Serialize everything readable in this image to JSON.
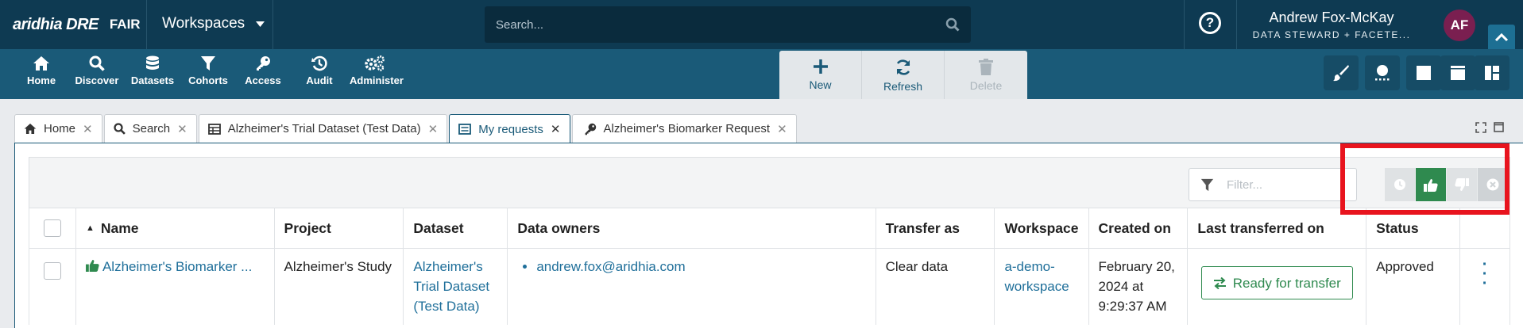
{
  "brand": {
    "logo": "aridhia DRE",
    "fair": "FAIR"
  },
  "header": {
    "workspaces_label": "Workspaces",
    "search_placeholder": "Search...",
    "help": "?",
    "user_name": "Andrew Fox-McKay",
    "user_role": "DATA STEWARD + FACETE...",
    "avatar_initials": "AF"
  },
  "nav": [
    {
      "label": "Home",
      "icon": "home-icon"
    },
    {
      "label": "Discover",
      "icon": "search-icon"
    },
    {
      "label": "Datasets",
      "icon": "database-icon"
    },
    {
      "label": "Cohorts",
      "icon": "filter-icon"
    },
    {
      "label": "Access",
      "icon": "key-icon"
    },
    {
      "label": "Audit",
      "icon": "history-icon"
    },
    {
      "label": "Administer",
      "icon": "cogs-icon"
    }
  ],
  "actions": {
    "new": "New",
    "refresh": "Refresh",
    "delete": "Delete"
  },
  "tabs": [
    {
      "label": "Home",
      "icon": "home-icon"
    },
    {
      "label": "Search",
      "icon": "search-icon"
    },
    {
      "label": "Alzheimer's Trial Dataset (Test Data)",
      "icon": "table-icon"
    },
    {
      "label": "My requests",
      "icon": "list-icon"
    },
    {
      "label": "Alzheimer's Biomarker Request",
      "icon": "key-icon"
    }
  ],
  "filter": {
    "placeholder": "Filter..."
  },
  "status_filters": [
    "pending",
    "approved",
    "rejected",
    "cancelled"
  ],
  "table": {
    "columns": [
      "Name",
      "Project",
      "Dataset",
      "Data owners",
      "Transfer as",
      "Workspace",
      "Created on",
      "Last transferred on",
      "Status"
    ],
    "rows": [
      {
        "name": "Alzheimer's Biomarker ...",
        "project": "Alzheimer's Study",
        "dataset": "Alzheimer's Trial Dataset (Test Data)",
        "owner": "andrew.fox@aridhia.com",
        "transfer_as": "Clear data",
        "workspace": "a-demo-workspace",
        "created_on": "February 20, 2024 at 9:29:37 AM",
        "last_transferred": "Ready for transfer",
        "status": "Approved"
      }
    ]
  },
  "colors": {
    "header": "#0e3a52",
    "toolbar": "#1a5a78",
    "approved": "#2f8a4f",
    "link": "#1f6f9a",
    "highlight": "#e8141e"
  }
}
